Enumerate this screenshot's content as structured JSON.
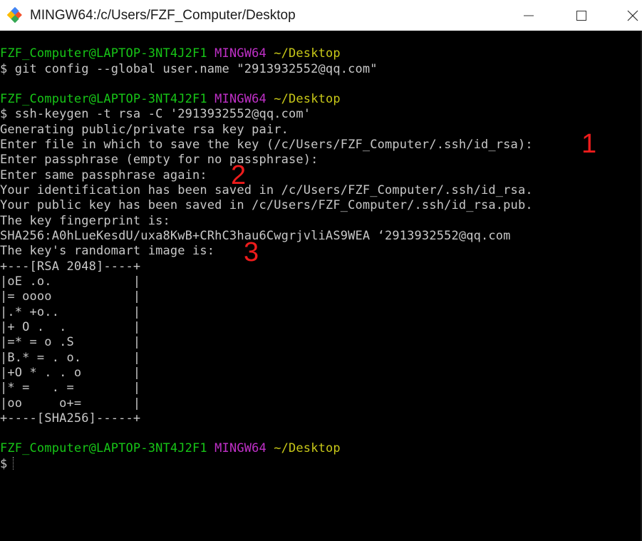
{
  "window": {
    "title": "MINGW64:/c/Users/FZF_Computer/Desktop",
    "icons": [
      "git-bash-app-icon",
      "minimize-icon",
      "maximize-icon",
      "close-icon"
    ]
  },
  "colors": {
    "terminal_bg": "#000000",
    "prompt_user": "#17c617",
    "prompt_shell": "#c030c8",
    "prompt_path": "#c8c818",
    "text": "#c8c8c8",
    "annotation": "#ee1c1c"
  },
  "prompt": {
    "user_host": "FZF_Computer@LAPTOP-3NT4J2F1",
    "shell": "MINGW64",
    "path": "~/Desktop"
  },
  "lines": [
    "$ git config --global user.name \"2913932552@qq.com\"",
    "$ ssh-keygen -t rsa -C '2913932552@qq.com'",
    "Generating public/private rsa key pair.",
    "Enter file in which to save the key (/c/Users/FZF_Computer/.ssh/id_rsa):",
    "Enter passphrase (empty for no passphrase):",
    "Enter same passphrase again:",
    "Your identification has been saved in /c/Users/FZF_Computer/.ssh/id_rsa.",
    "Your public key has been saved in /c/Users/FZF_Computer/.ssh/id_rsa.pub.",
    "The key fingerprint is:",
    "SHA256:A0hLueKesdU/uxa8KwB+CRhC3hau6CwgrjvliAS9WEA ‘2913932552@qq.com",
    "The key's randomart image is:",
    "+---[RSA 2048]----+",
    "|oE .o.           |",
    "|= oooo           |",
    "|.* +o..          |",
    "|+ O .  .         |",
    "|=* = o .S        |",
    "|B.* = . o.       |",
    "|+O * . . o       |",
    "|* =   . =        |",
    "|oo     o+=       |",
    "+----[SHA256]-----+",
    "$"
  ],
  "annotations": [
    "1",
    "2",
    "3"
  ]
}
